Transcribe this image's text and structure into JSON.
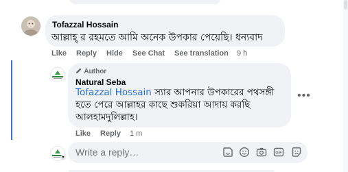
{
  "comment": {
    "author": "Tofazzal Hossain",
    "text": "আল্লাহ্ র রহমতে আমি অনেক উপকার পেয়েছি। ধন্যবাদ",
    "actions": {
      "like": "Like",
      "reply": "Reply",
      "hide": "Hide",
      "see_chat": "See Chat",
      "see_translation": "See translation",
      "time": "9 h"
    }
  },
  "reply": {
    "badge": "Author",
    "author": "Natural Seba",
    "mention": "Tofazzal Hossain",
    "text": " স্যার আপনার উপকারের পথসঙ্গী হতে পেরে আল্লাহর কাছে শুকরিয়া আদায় করছি আলহামদুলিল্লাহ।",
    "actions": {
      "like": "Like",
      "reply": "Reply",
      "time": "1 m"
    },
    "more_label": "•••"
  },
  "composer": {
    "placeholder": "Write a reply…",
    "tools": [
      "sticker-icon",
      "emoji-icon",
      "camera-icon",
      "gif-icon",
      "avatar-sticker-icon"
    ]
  },
  "colors": {
    "bubble": "#f0f2f5",
    "link": "#216fdb",
    "muted": "#65676b",
    "thread": "#3b6fd6"
  }
}
